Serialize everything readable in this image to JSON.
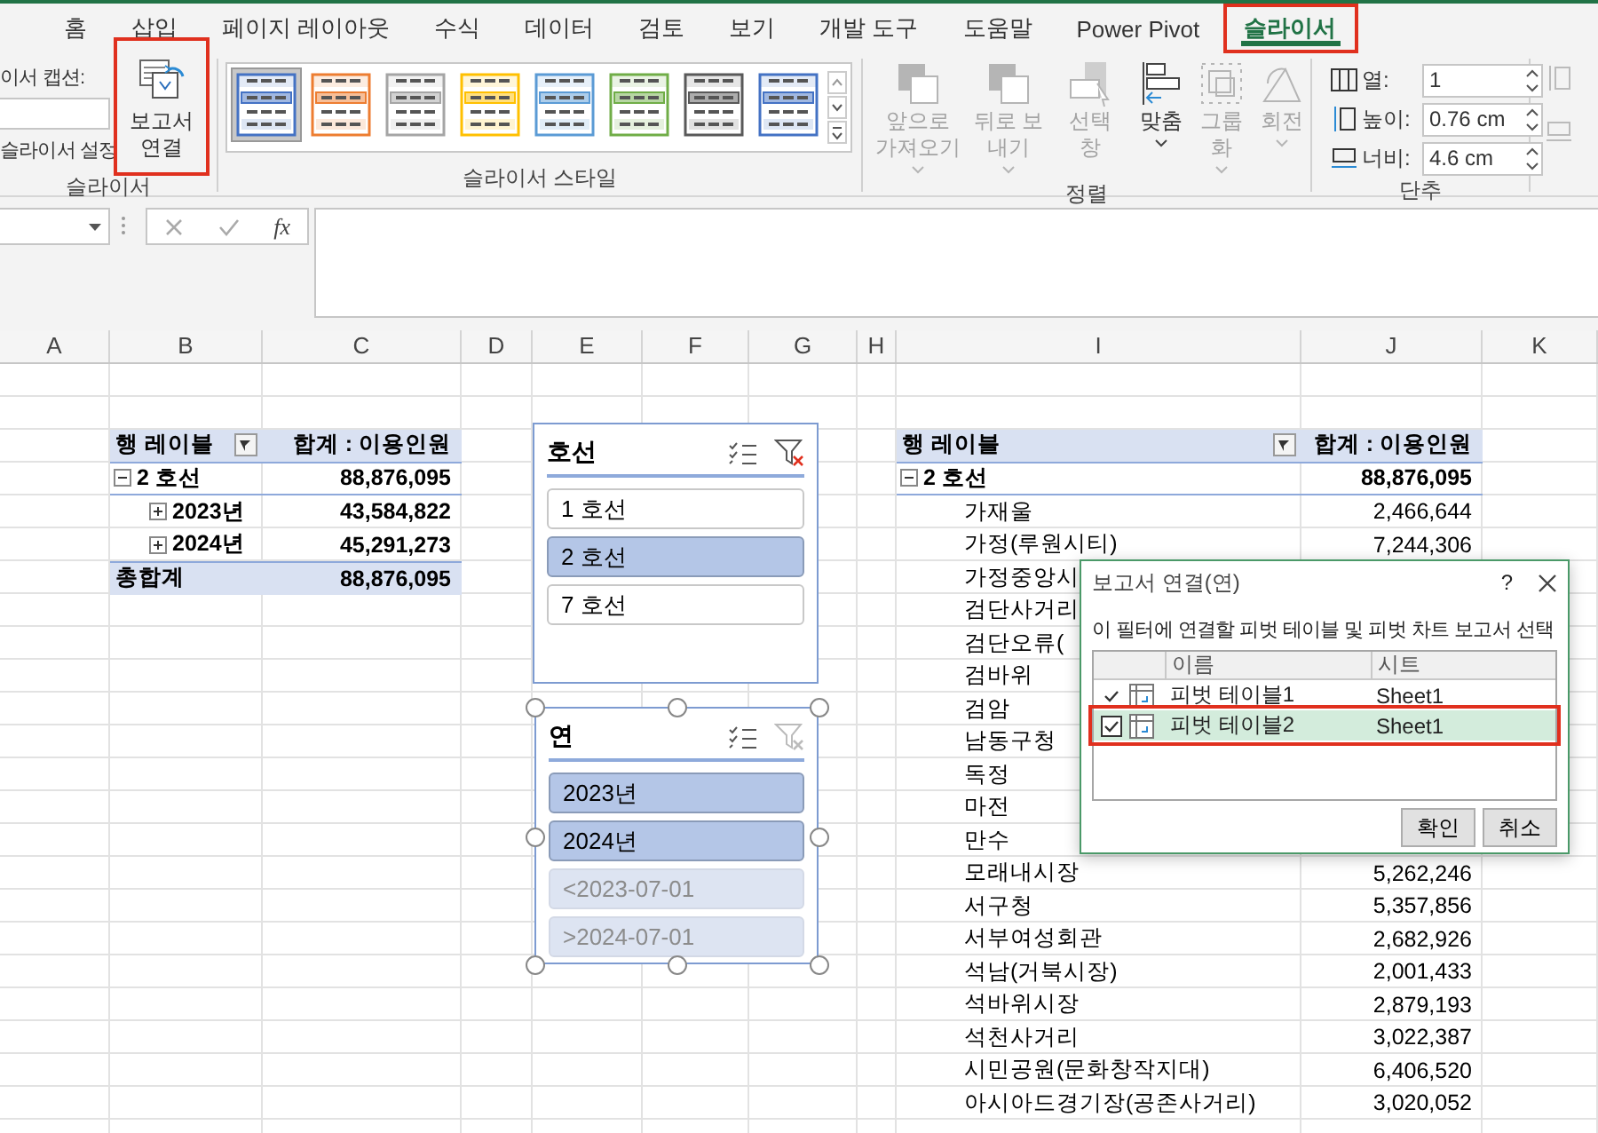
{
  "ribbon": {
    "tabs": [
      {
        "label": "홈",
        "selected": false,
        "highlighted": false
      },
      {
        "label": "삽입",
        "selected": false,
        "highlighted": false
      },
      {
        "label": "페이지 레이아웃",
        "selected": false,
        "highlighted": false
      },
      {
        "label": "수식",
        "selected": false,
        "highlighted": false
      },
      {
        "label": "데이터",
        "selected": false,
        "highlighted": false
      },
      {
        "label": "검토",
        "selected": false,
        "highlighted": false
      },
      {
        "label": "보기",
        "selected": false,
        "highlighted": false
      },
      {
        "label": "개발 도구",
        "selected": false,
        "highlighted": false
      },
      {
        "label": "도움말",
        "selected": false,
        "highlighted": false
      },
      {
        "label": "Power Pivot",
        "selected": false,
        "highlighted": false
      },
      {
        "label": "슬라이서",
        "selected": true,
        "highlighted": true
      }
    ],
    "slicer_group": {
      "caption_label": "이서 캡션:",
      "settings_label": "슬라이서 설정",
      "report_connections": {
        "label": "보고서 연결",
        "highlighted": true
      },
      "label": "슬라이서"
    },
    "styles_group": {
      "styles": [
        {
          "color": "#4472c4",
          "selected": true
        },
        {
          "color": "#ed7d31",
          "selected": false
        },
        {
          "color": "#a5a5a5",
          "selected": false
        },
        {
          "color": "#ffc000",
          "selected": false
        },
        {
          "color": "#5b9bd5",
          "selected": false
        },
        {
          "color": "#70ad47",
          "selected": false
        },
        {
          "color": "#595959",
          "selected": false
        },
        {
          "color": "#4472c4",
          "selected": false
        }
      ],
      "label": "슬라이서 스타일"
    },
    "arrange_group": {
      "buttons": [
        {
          "label": "앞으로 가져오기",
          "disabled": true
        },
        {
          "label": "뒤로 보내기",
          "disabled": true
        },
        {
          "label": "선택 창",
          "disabled": true
        },
        {
          "label": "맞춤",
          "disabled": false
        },
        {
          "label": "그룹화",
          "disabled": true
        },
        {
          "label": "회전",
          "disabled": true
        }
      ],
      "label": "정렬"
    },
    "buttons_group": {
      "fields": [
        {
          "label": "열:",
          "value": "1"
        },
        {
          "label": "높이:",
          "value": "0.76 cm"
        },
        {
          "label": "너비:",
          "value": "4.6 cm"
        }
      ],
      "label": "단추"
    }
  },
  "formula_bar": {
    "function_label": "fx"
  },
  "sheet": {
    "columns": [
      "A",
      "B",
      "C",
      "D",
      "E",
      "F",
      "G",
      "H",
      "I",
      "J",
      "K"
    ],
    "pivot_tables": [
      {
        "header": [
          "행 레이블",
          "합계 : 이용인원"
        ],
        "rows": [
          {
            "label": "2 호선",
            "value": "88,876,095",
            "kind": "group",
            "expanded": true
          },
          {
            "label": "2023년",
            "value": "43,584,822",
            "kind": "item",
            "expanded": false
          },
          {
            "label": "2024년",
            "value": "45,291,273",
            "kind": "item",
            "expanded": false
          },
          {
            "label": "총합계",
            "value": "88,876,095",
            "kind": "total"
          }
        ]
      },
      {
        "header": [
          "행 레이블",
          "합계 : 이용인원"
        ],
        "rows": [
          {
            "label": "2 호선",
            "value": "88,876,095",
            "kind": "group",
            "expanded": true
          },
          {
            "label": "가재울",
            "value": "2,466,644",
            "kind": "leaf"
          },
          {
            "label": "가정(루원시티)",
            "value": "7,244,306",
            "kind": "leaf"
          },
          {
            "label": "가정중앙시",
            "kind": "leaf"
          },
          {
            "label": "검단사거리",
            "kind": "leaf"
          },
          {
            "label": "검단오류(",
            "kind": "leaf"
          },
          {
            "label": "검바위",
            "kind": "leaf"
          },
          {
            "label": "검암",
            "kind": "leaf"
          },
          {
            "label": "남동구청",
            "kind": "leaf"
          },
          {
            "label": "독정",
            "kind": "leaf"
          },
          {
            "label": "마전",
            "kind": "leaf"
          },
          {
            "label": "만수",
            "kind": "leaf"
          },
          {
            "label": "모래내시장",
            "value": "5,262,246",
            "kind": "leaf"
          },
          {
            "label": "서구청",
            "value": "5,357,856",
            "kind": "leaf"
          },
          {
            "label": "서부여성회관",
            "value": "2,682,926",
            "kind": "leaf"
          },
          {
            "label": "석남(거북시장)",
            "value": "2,001,433",
            "kind": "leaf"
          },
          {
            "label": "석바위시장",
            "value": "2,879,193",
            "kind": "leaf"
          },
          {
            "label": "석천사거리",
            "value": "3,022,387",
            "kind": "leaf"
          },
          {
            "label": "시민공원(문화창작지대)",
            "value": "6,406,520",
            "kind": "leaf"
          },
          {
            "label": "아시아드경기장(공존사거리)",
            "value": "3,020,052",
            "kind": "leaf"
          }
        ]
      }
    ],
    "slicers": [
      {
        "title": "호선",
        "clear_filter_enabled": true,
        "selected": false,
        "items": [
          {
            "label": "1 호선",
            "selected": false,
            "disabled": false
          },
          {
            "label": "2 호선",
            "selected": true,
            "disabled": false
          },
          {
            "label": "7 호선",
            "selected": false,
            "disabled": false
          }
        ]
      },
      {
        "title": "연",
        "clear_filter_enabled": false,
        "selected": true,
        "items": [
          {
            "label": "2023년",
            "selected": true,
            "disabled": false
          },
          {
            "label": "2024년",
            "selected": true,
            "disabled": false
          },
          {
            "label": "<2023-07-01",
            "selected": false,
            "disabled": true
          },
          {
            "label": ">2024-07-01",
            "selected": false,
            "disabled": true
          }
        ]
      }
    ],
    "dialog": {
      "title": "보고서 연결(연)",
      "help_label": "?",
      "instruction": "이 필터에 연결할 피벗 테이블 및 피벗 차트 보고서 선택",
      "columns": [
        "이름",
        "시트"
      ],
      "rows": [
        {
          "name": "피벗 테이블1",
          "sheet": "Sheet1",
          "checked": true,
          "selected": false,
          "highlighted": false
        },
        {
          "name": "피벗 테이블2",
          "sheet": "Sheet1",
          "checked": true,
          "selected": true,
          "highlighted": true
        }
      ],
      "buttons": [
        "확인",
        "취소"
      ]
    }
  }
}
